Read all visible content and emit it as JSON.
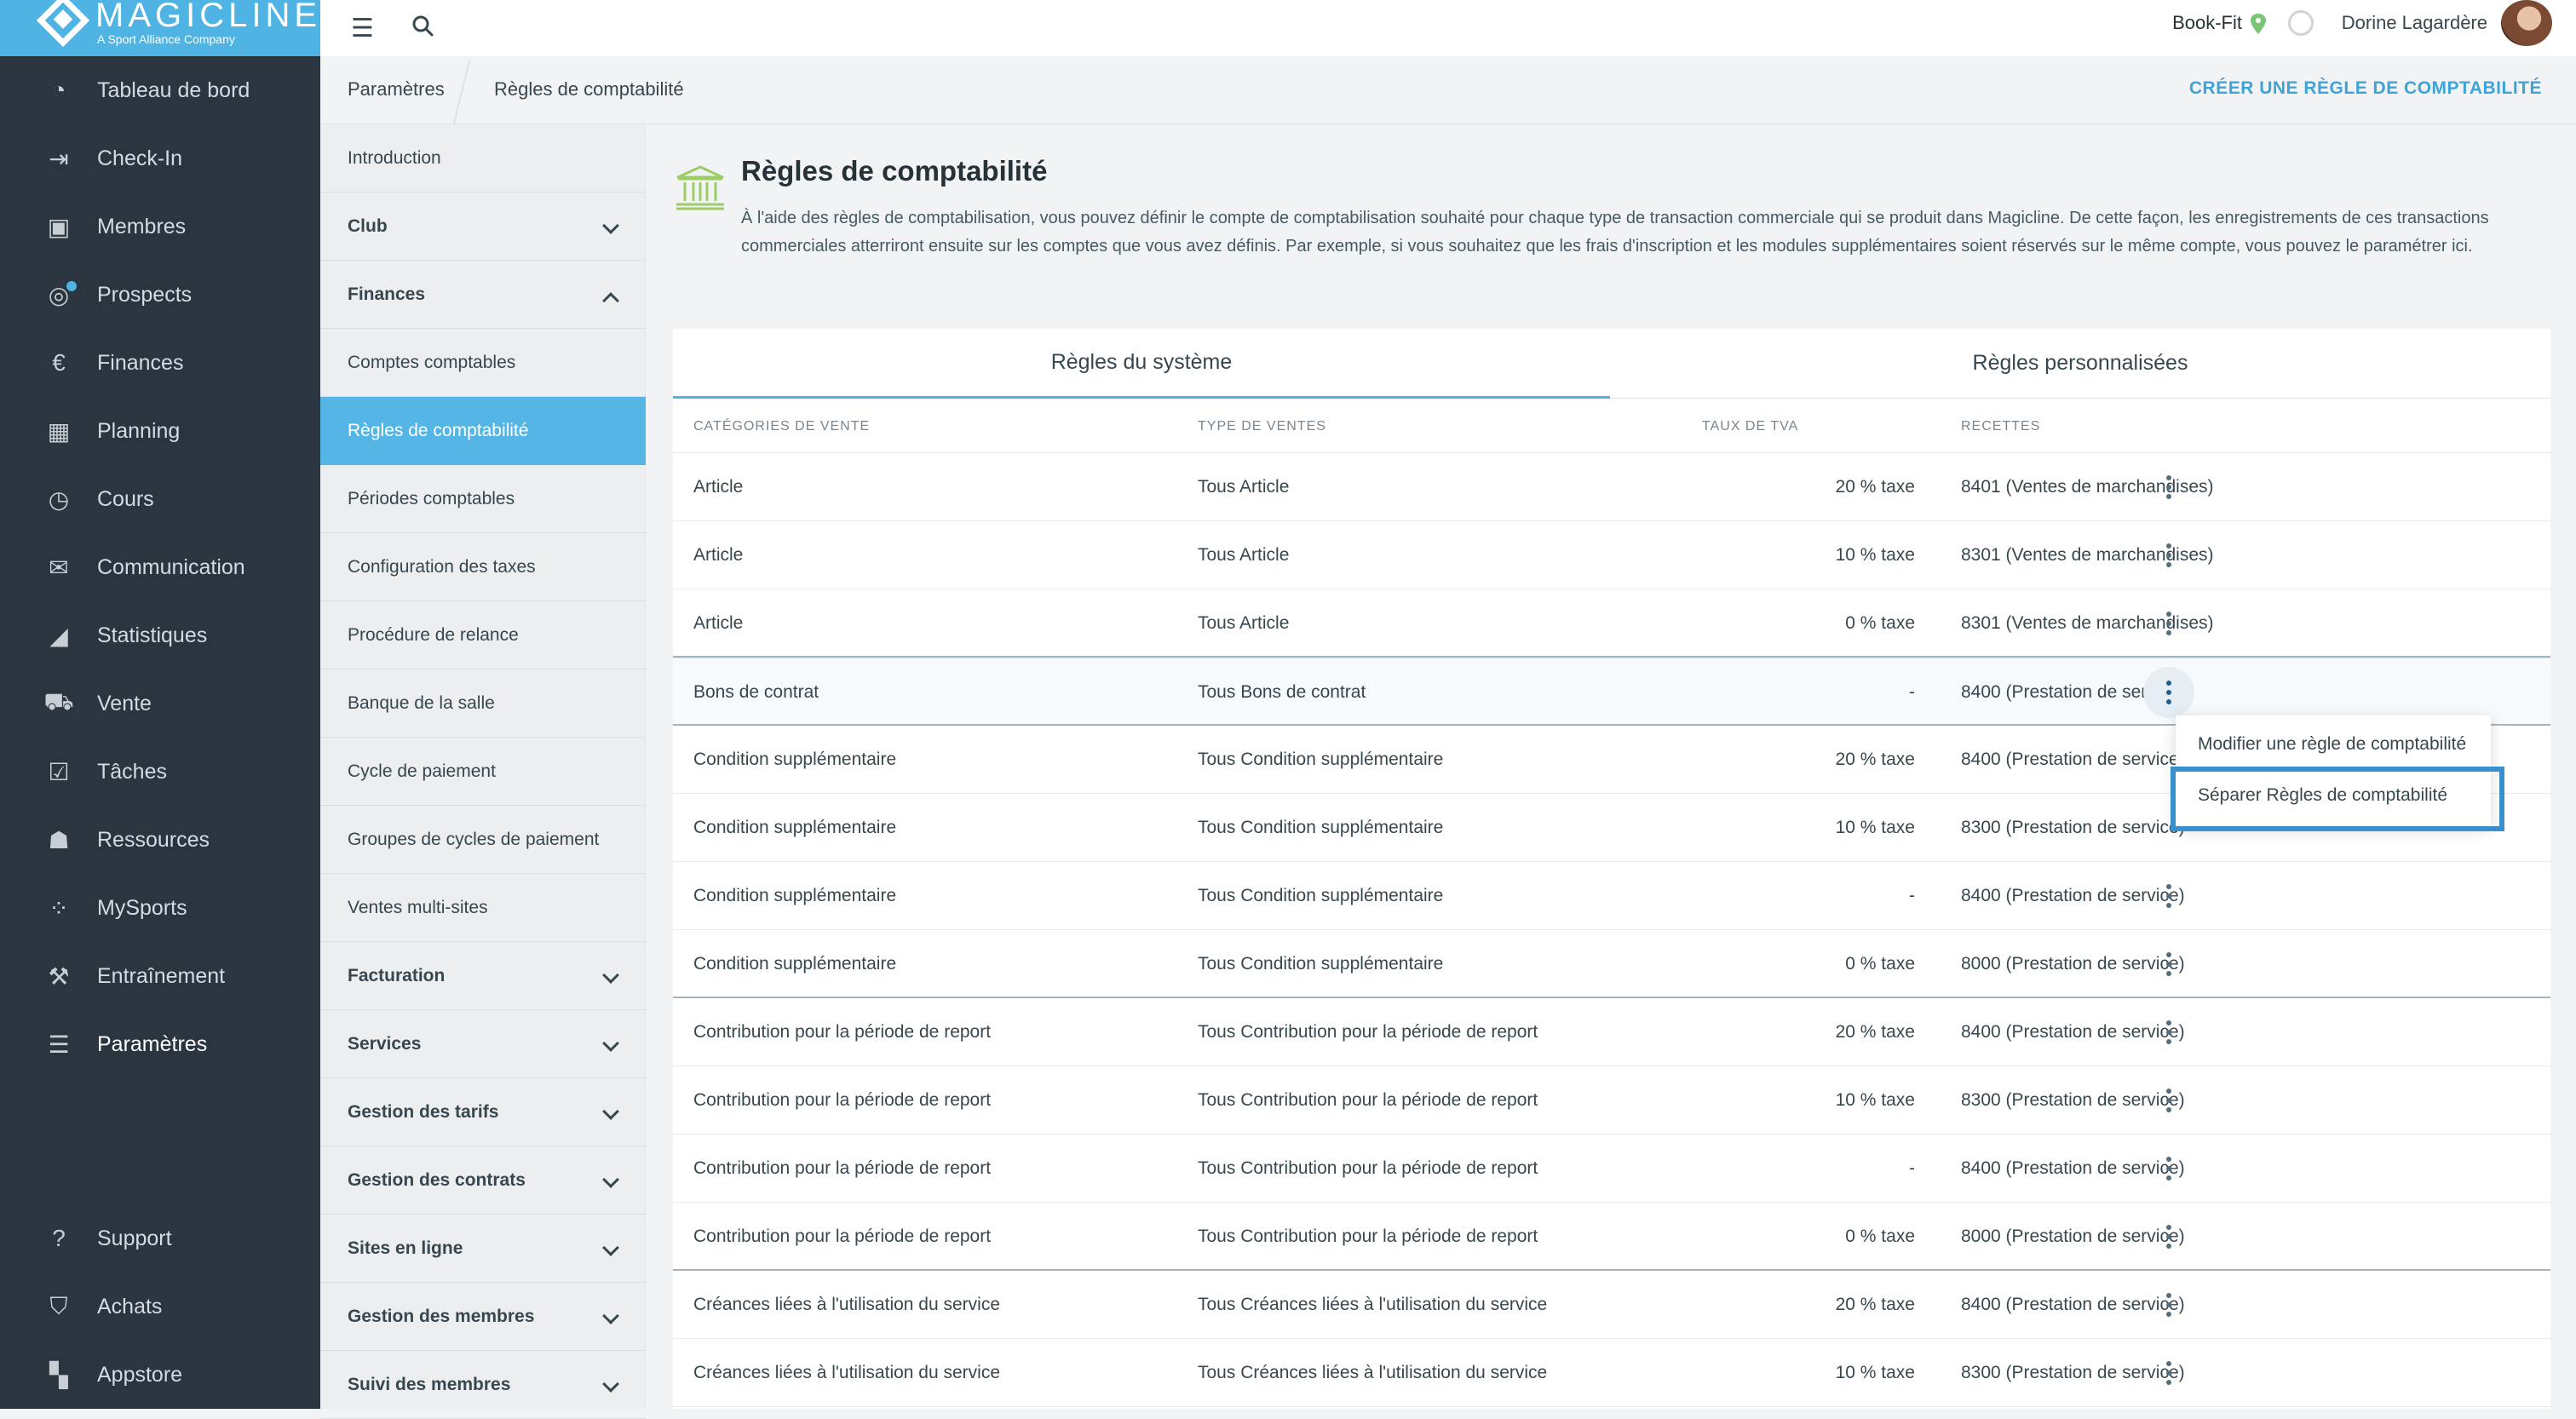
{
  "brand": {
    "name": "MAGICLINE",
    "tagline": "A Sport Alliance Company"
  },
  "nav": {
    "items": [
      {
        "label": "Tableau de bord",
        "icon": "dashboard-icon"
      },
      {
        "label": "Check-In",
        "icon": "check-in-icon"
      },
      {
        "label": "Membres",
        "icon": "members-icon"
      },
      {
        "label": "Prospects",
        "icon": "prospects-icon"
      },
      {
        "label": "Finances",
        "icon": "euro-icon"
      },
      {
        "label": "Planning",
        "icon": "calendar-icon"
      },
      {
        "label": "Cours",
        "icon": "stopwatch-icon"
      },
      {
        "label": "Communication",
        "icon": "chat-icon"
      },
      {
        "label": "Statistiques",
        "icon": "chart-icon"
      },
      {
        "label": "Vente",
        "icon": "cart-icon"
      },
      {
        "label": "Tâches",
        "icon": "checkbox-icon"
      },
      {
        "label": "Ressources",
        "icon": "group-icon"
      },
      {
        "label": "MySports",
        "icon": "dots-grid-icon"
      },
      {
        "label": "Entraînement",
        "icon": "dumbbell-icon"
      },
      {
        "label": "Paramètres",
        "icon": "sliders-icon"
      }
    ],
    "bottom": [
      {
        "label": "Support",
        "icon": "help-icon"
      },
      {
        "label": "Achats",
        "icon": "bag-icon"
      },
      {
        "label": "Appstore",
        "icon": "apps-icon"
      }
    ]
  },
  "topbar": {
    "studio": "Book-Fit",
    "user": "Dorine Lagardère"
  },
  "breadcrumb": {
    "parent": "Paramètres",
    "current": "Règles de comptabilité",
    "action": "CRÉER UNE RÈGLE DE COMPTABILITÉ"
  },
  "subnav": [
    {
      "label": "Introduction",
      "type": "item"
    },
    {
      "label": "Club",
      "type": "section",
      "chevron": "down"
    },
    {
      "label": "Finances",
      "type": "section",
      "chevron": "up"
    },
    {
      "label": "Comptes comptables",
      "type": "item"
    },
    {
      "label": "Règles de comptabilité",
      "type": "item",
      "active": true
    },
    {
      "label": "Périodes comptables",
      "type": "item"
    },
    {
      "label": "Configuration des taxes",
      "type": "item"
    },
    {
      "label": "Procédure de relance",
      "type": "item"
    },
    {
      "label": "Banque de la salle",
      "type": "item"
    },
    {
      "label": "Cycle de paiement",
      "type": "item"
    },
    {
      "label": "Groupes de cycles de paiement",
      "type": "item"
    },
    {
      "label": "Ventes multi-sites",
      "type": "item"
    },
    {
      "label": "Facturation",
      "type": "section",
      "chevron": "down"
    },
    {
      "label": "Services",
      "type": "section",
      "chevron": "down"
    },
    {
      "label": "Gestion des tarifs",
      "type": "section",
      "chevron": "down"
    },
    {
      "label": "Gestion des contrats",
      "type": "section",
      "chevron": "down"
    },
    {
      "label": "Sites en ligne",
      "type": "section",
      "chevron": "down"
    },
    {
      "label": "Gestion des membres",
      "type": "section",
      "chevron": "down"
    },
    {
      "label": "Suivi des membres",
      "type": "section",
      "chevron": "down"
    }
  ],
  "page": {
    "title": "Règles de comptabilité",
    "description": "À l'aide des règles de comptabilisation, vous pouvez définir le compte de comptabilisation souhaité pour chaque type de transaction commerciale qui se produit dans Magicline. De cette façon, les enregistrements de ces transactions commerciales atterriront ensuite sur les comptes que vous avez définis. Par exemple, si vous souhaitez que les frais d'inscription et les modules supplémentaires soient réservés sur le même compte, vous pouvez le paramétrer ici."
  },
  "tabs": {
    "system": "Règles du système",
    "custom": "Règles personnalisées"
  },
  "table": {
    "headers": {
      "category": "CATÉGORIES DE VENTE",
      "type": "TYPE DE VENTES",
      "vat": "TAUX DE TVA",
      "revenue": "RECETTES"
    },
    "rows": [
      {
        "category": "Article",
        "type": "Tous Article",
        "vat": "20 % taxe",
        "revenue": "8401 (Ventes de marchandises)"
      },
      {
        "category": "Article",
        "type": "Tous Article",
        "vat": "10 % taxe",
        "revenue": "8301 (Ventes de marchandises)"
      },
      {
        "category": "Article",
        "type": "Tous Article",
        "vat": "0 % taxe",
        "revenue": "8301 (Ventes de marchandises)"
      },
      {
        "category": "Bons de contrat",
        "type": "Tous Bons de contrat",
        "vat": "-",
        "revenue": "8400 (Prestation de service)"
      },
      {
        "category": "Condition supplémentaire",
        "type": "Tous Condition supplémentaire",
        "vat": "20 % taxe",
        "revenue": "8400 (Prestation de service)"
      },
      {
        "category": "Condition supplémentaire",
        "type": "Tous Condition supplémentaire",
        "vat": "10 % taxe",
        "revenue": "8300 (Prestation de service)"
      },
      {
        "category": "Condition supplémentaire",
        "type": "Tous Condition supplémentaire",
        "vat": "-",
        "revenue": "8400 (Prestation de service)"
      },
      {
        "category": "Condition supplémentaire",
        "type": "Tous Condition supplémentaire",
        "vat": "0 % taxe",
        "revenue": "8000 (Prestation de service)"
      },
      {
        "category": "Contribution pour la période de report",
        "type": "Tous Contribution pour la période de report",
        "vat": "20 % taxe",
        "revenue": "8400 (Prestation de service)"
      },
      {
        "category": "Contribution pour la période de report",
        "type": "Tous Contribution pour la période de report",
        "vat": "10 % taxe",
        "revenue": "8300 (Prestation de service)"
      },
      {
        "category": "Contribution pour la période de report",
        "type": "Tous Contribution pour la période de report",
        "vat": "-",
        "revenue": "8400 (Prestation de service)"
      },
      {
        "category": "Contribution pour la période de report",
        "type": "Tous Contribution pour la période de report",
        "vat": "0 % taxe",
        "revenue": "8000 (Prestation de service)"
      },
      {
        "category": "Créances liées à l'utilisation du service",
        "type": "Tous Créances liées à l'utilisation du service",
        "vat": "20 % taxe",
        "revenue": "8400 (Prestation de service)"
      },
      {
        "category": "Créances liées à l'utilisation du service",
        "type": "Tous Créances liées à l'utilisation du service",
        "vat": "10 % taxe",
        "revenue": "8300 (Prestation de service)"
      }
    ]
  },
  "context_menu": {
    "edit": "Modifier une règle de comptabilité",
    "split": "Séparer Règles de comptabilité"
  },
  "colors": {
    "accent": "#4fb3e3",
    "nav_bg": "#2a3540",
    "focus": "#3a8fce"
  }
}
